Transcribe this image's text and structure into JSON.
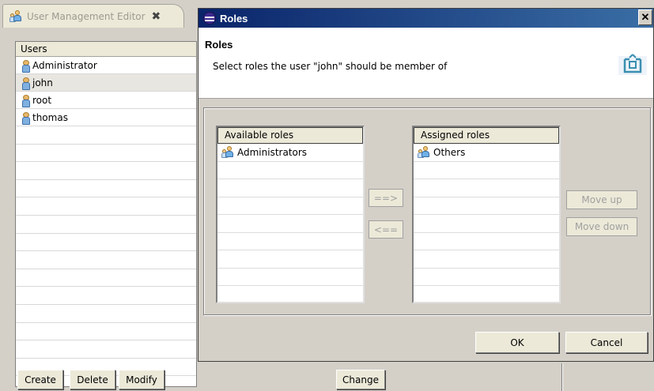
{
  "editor": {
    "tab_title": "User Management Editor",
    "users_header": "Users",
    "users": [
      {
        "name": "Administrator",
        "selected": false
      },
      {
        "name": "john",
        "selected": true
      },
      {
        "name": "root",
        "selected": false
      },
      {
        "name": "thomas",
        "selected": false
      }
    ],
    "buttons": {
      "create": "Create",
      "delete": "Delete",
      "modify": "Modify",
      "change": "Change"
    }
  },
  "dialog": {
    "window_title": "Roles",
    "title": "Roles",
    "message": "Select roles the user \"john\" should be member of",
    "available_header": "Available roles",
    "available_roles": [
      "Administrators"
    ],
    "assigned_header": "Assigned roles",
    "assigned_roles": [
      "Others"
    ],
    "buttons": {
      "add": "==>",
      "remove": "<==",
      "move_up": "Move up",
      "move_down": "Move down",
      "ok": "OK",
      "cancel": "Cancel"
    }
  },
  "icons": {
    "user": "user-icon",
    "group": "group-icon",
    "close": "close-icon",
    "eclipse": "eclipse-icon",
    "header_graphic": "wizard-banner-icon"
  },
  "colors": {
    "titlebar_start": "#0a246a",
    "titlebar_end": "#3a6ea5",
    "background": "#d4d0c8"
  }
}
